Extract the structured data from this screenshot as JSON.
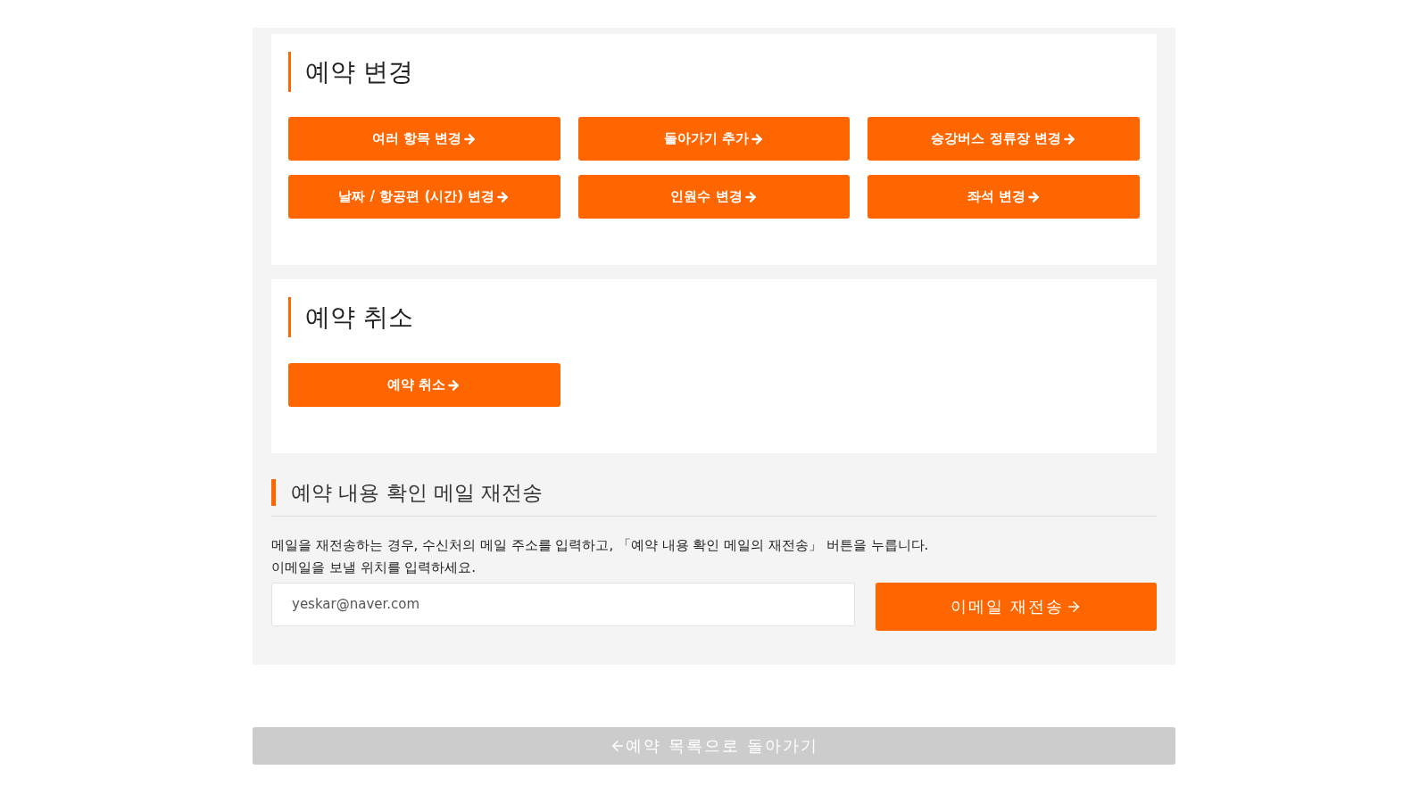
{
  "change_section": {
    "title": "예약 변경",
    "buttons": [
      {
        "label": "여러 항목 변경"
      },
      {
        "label": "돌아가기 추가"
      },
      {
        "label": "승강버스 정류장 변경"
      },
      {
        "label": "날짜 / 항공편 (시간) 변경"
      },
      {
        "label": "인원수 변경"
      },
      {
        "label": "좌석 변경"
      }
    ]
  },
  "cancel_section": {
    "title": "예약 취소",
    "buttons": [
      {
        "label": "예약 취소"
      }
    ]
  },
  "resend_section": {
    "title": "예약 내용 확인 메일 재전송",
    "description": [
      "메일을 재전송하는 경우, 수신처의 메일 주소를 입력하고, 「예약 내용 확인 메일의 재전송」 버튼을 누릅니다.",
      "이메일을 보낼 위치를 입력하세요."
    ],
    "email": {
      "value": "yeskar@naver.com"
    },
    "button": "이메일 재전송"
  },
  "back_button": "예약 목록으로 돌아가기"
}
